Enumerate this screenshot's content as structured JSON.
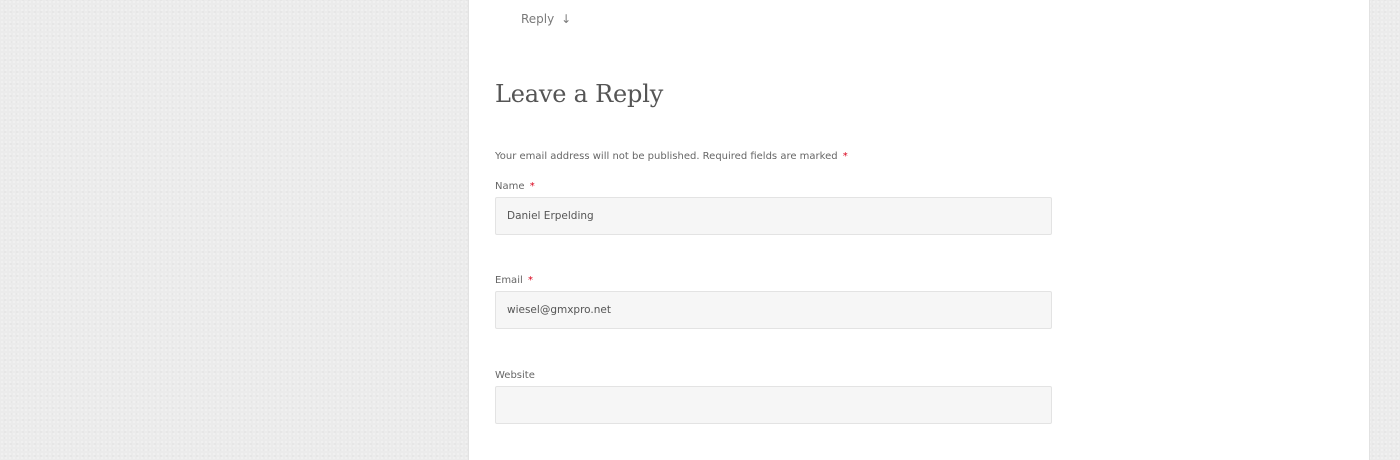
{
  "comment": {
    "reply_link_label": "Reply",
    "reply_arrow": "↓"
  },
  "respond": {
    "title": "Leave a Reply",
    "notes_text": "Your email address will not be published. Required fields are marked",
    "required_marker": "*"
  },
  "form": {
    "name": {
      "label": "Name",
      "required_marker": "*",
      "value": "Daniel Erpelding"
    },
    "email": {
      "label": "Email",
      "required_marker": "*",
      "value": "wiesel@gmxpro.net"
    },
    "website": {
      "label": "Website",
      "value": ""
    }
  }
}
